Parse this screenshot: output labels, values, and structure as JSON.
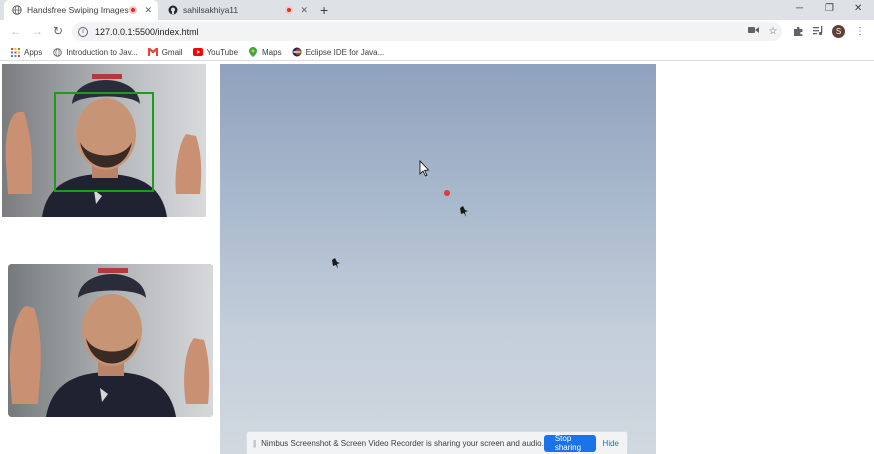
{
  "tabs": [
    {
      "title": "Handsfree Swiping Images",
      "active": true,
      "recording": true
    },
    {
      "title": "sahilsakhiya11",
      "active": false,
      "recording": true
    }
  ],
  "new_tab": "+",
  "window": {
    "minimize": "─",
    "restore": "❐",
    "close": "✕"
  },
  "toolbar": {
    "url": "127.0.0.1:5500/index.html",
    "avatar_letter": "S",
    "menu": "⋮"
  },
  "bookmarks": [
    {
      "label": "Apps",
      "icon": "apps-grid-icon"
    },
    {
      "label": "Introduction to Jav...",
      "icon": "globe-icon"
    },
    {
      "label": "Gmail",
      "icon": "gmail-icon"
    },
    {
      "label": "YouTube",
      "icon": "youtube-icon"
    },
    {
      "label": "Maps",
      "icon": "maps-pin-icon"
    },
    {
      "label": "Eclipse IDE for Java...",
      "icon": "eclipse-icon"
    }
  ],
  "share_bar": {
    "grip": "||",
    "message": "Nimbus Screenshot & Screen Video Recorder is sharing your screen and audio.",
    "stop_label": "Stop sharing",
    "hide_label": "Hide"
  },
  "colors": {
    "face_box": "#15a015",
    "cursor_dot": "#e53935",
    "share_button": "#1a73e8"
  }
}
